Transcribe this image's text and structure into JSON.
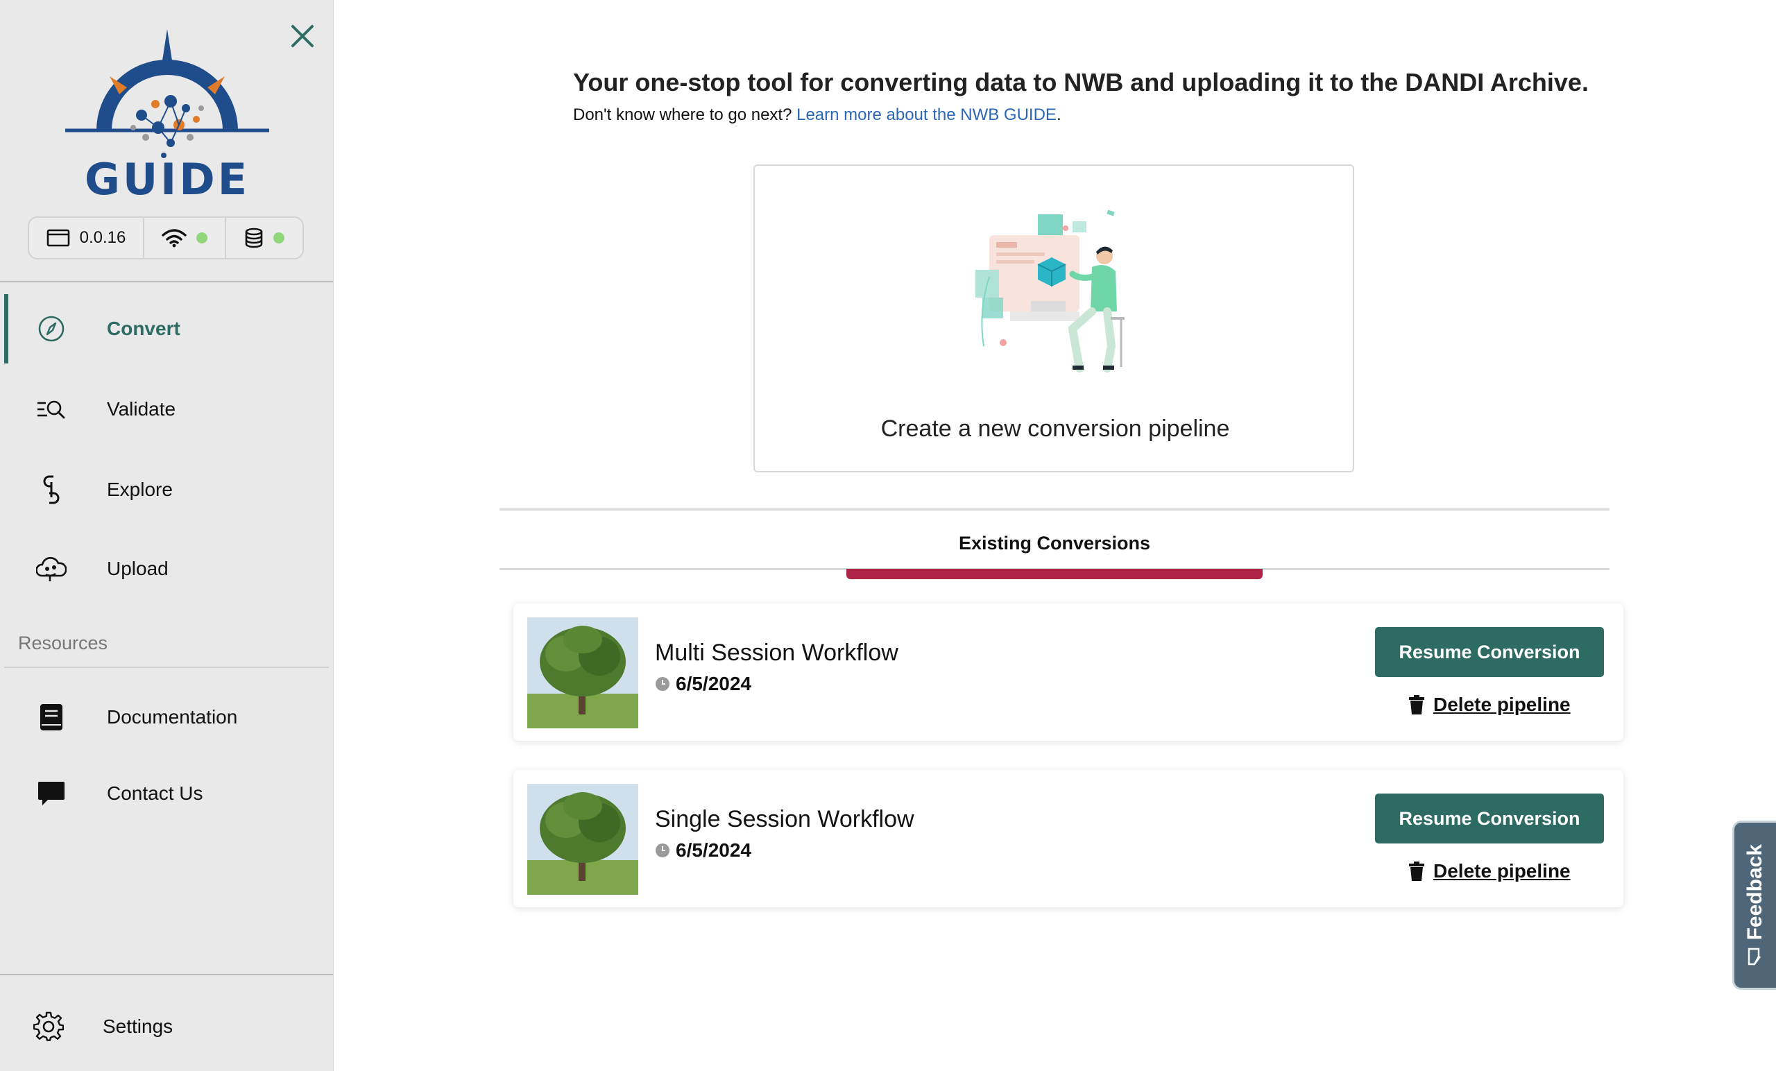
{
  "sidebar": {
    "logo_text": "GUIDE",
    "version": "0.0.16",
    "status": {
      "network_ok": true,
      "database_ok": true,
      "ok_color": "#8fd77a"
    },
    "nav": [
      {
        "label": "Convert",
        "icon": "compass-icon",
        "active": true
      },
      {
        "label": "Validate",
        "icon": "search-list-icon",
        "active": false
      },
      {
        "label": "Explore",
        "icon": "link-icon",
        "active": false
      },
      {
        "label": "Upload",
        "icon": "cloud-upload-icon",
        "active": false
      }
    ],
    "resources_title": "Resources",
    "resources": [
      {
        "label": "Documentation",
        "icon": "book-icon"
      },
      {
        "label": "Contact Us",
        "icon": "chat-icon"
      }
    ],
    "settings_label": "Settings"
  },
  "main": {
    "headline": "Your one-stop tool for converting data to NWB and uploading it to the DANDI Archive.",
    "subline_prefix": "Don't know where to go next? ",
    "subline_link": "Learn more about the NWB GUIDE",
    "subline_suffix": ".",
    "new_pipeline_label": "Create a new conversion pipeline",
    "tab_label": "Existing Conversions",
    "conversions": [
      {
        "title": "Multi Session Workflow",
        "date": "6/5/2024",
        "resume_label": "Resume Conversion",
        "delete_label": "Delete pipeline"
      },
      {
        "title": "Single Session Workflow",
        "date": "6/5/2024",
        "resume_label": "Resume Conversion",
        "delete_label": "Delete pipeline"
      }
    ]
  },
  "feedback_label": "Feedback",
  "colors": {
    "accent": "#2e6b63",
    "tab_underline": "#ad2447",
    "link": "#2b67b6",
    "logo_blue": "#1f4c8a"
  }
}
